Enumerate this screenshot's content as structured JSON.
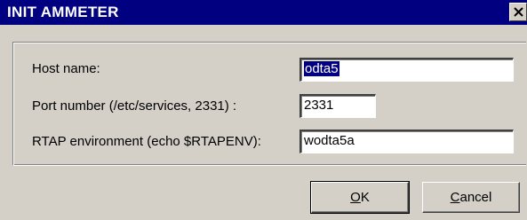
{
  "window": {
    "title": "INIT AMMETER"
  },
  "form": {
    "host": {
      "label": "Host name:",
      "value": "odta5"
    },
    "port": {
      "label": "Port number (/etc/services, 2331) :",
      "value": "2331"
    },
    "rtap": {
      "label": "RTAP environment (echo $RTAPENV):",
      "value": "wodta5a"
    }
  },
  "buttons": {
    "ok": {
      "mnemonic": "O",
      "rest": "K"
    },
    "cancel": {
      "mnemonic": "C",
      "rest": "ancel"
    }
  },
  "icons": {
    "close": "close-icon"
  },
  "colors": {
    "titlebar": "#000080",
    "face": "#d4d0c8",
    "selection": "#000080"
  }
}
